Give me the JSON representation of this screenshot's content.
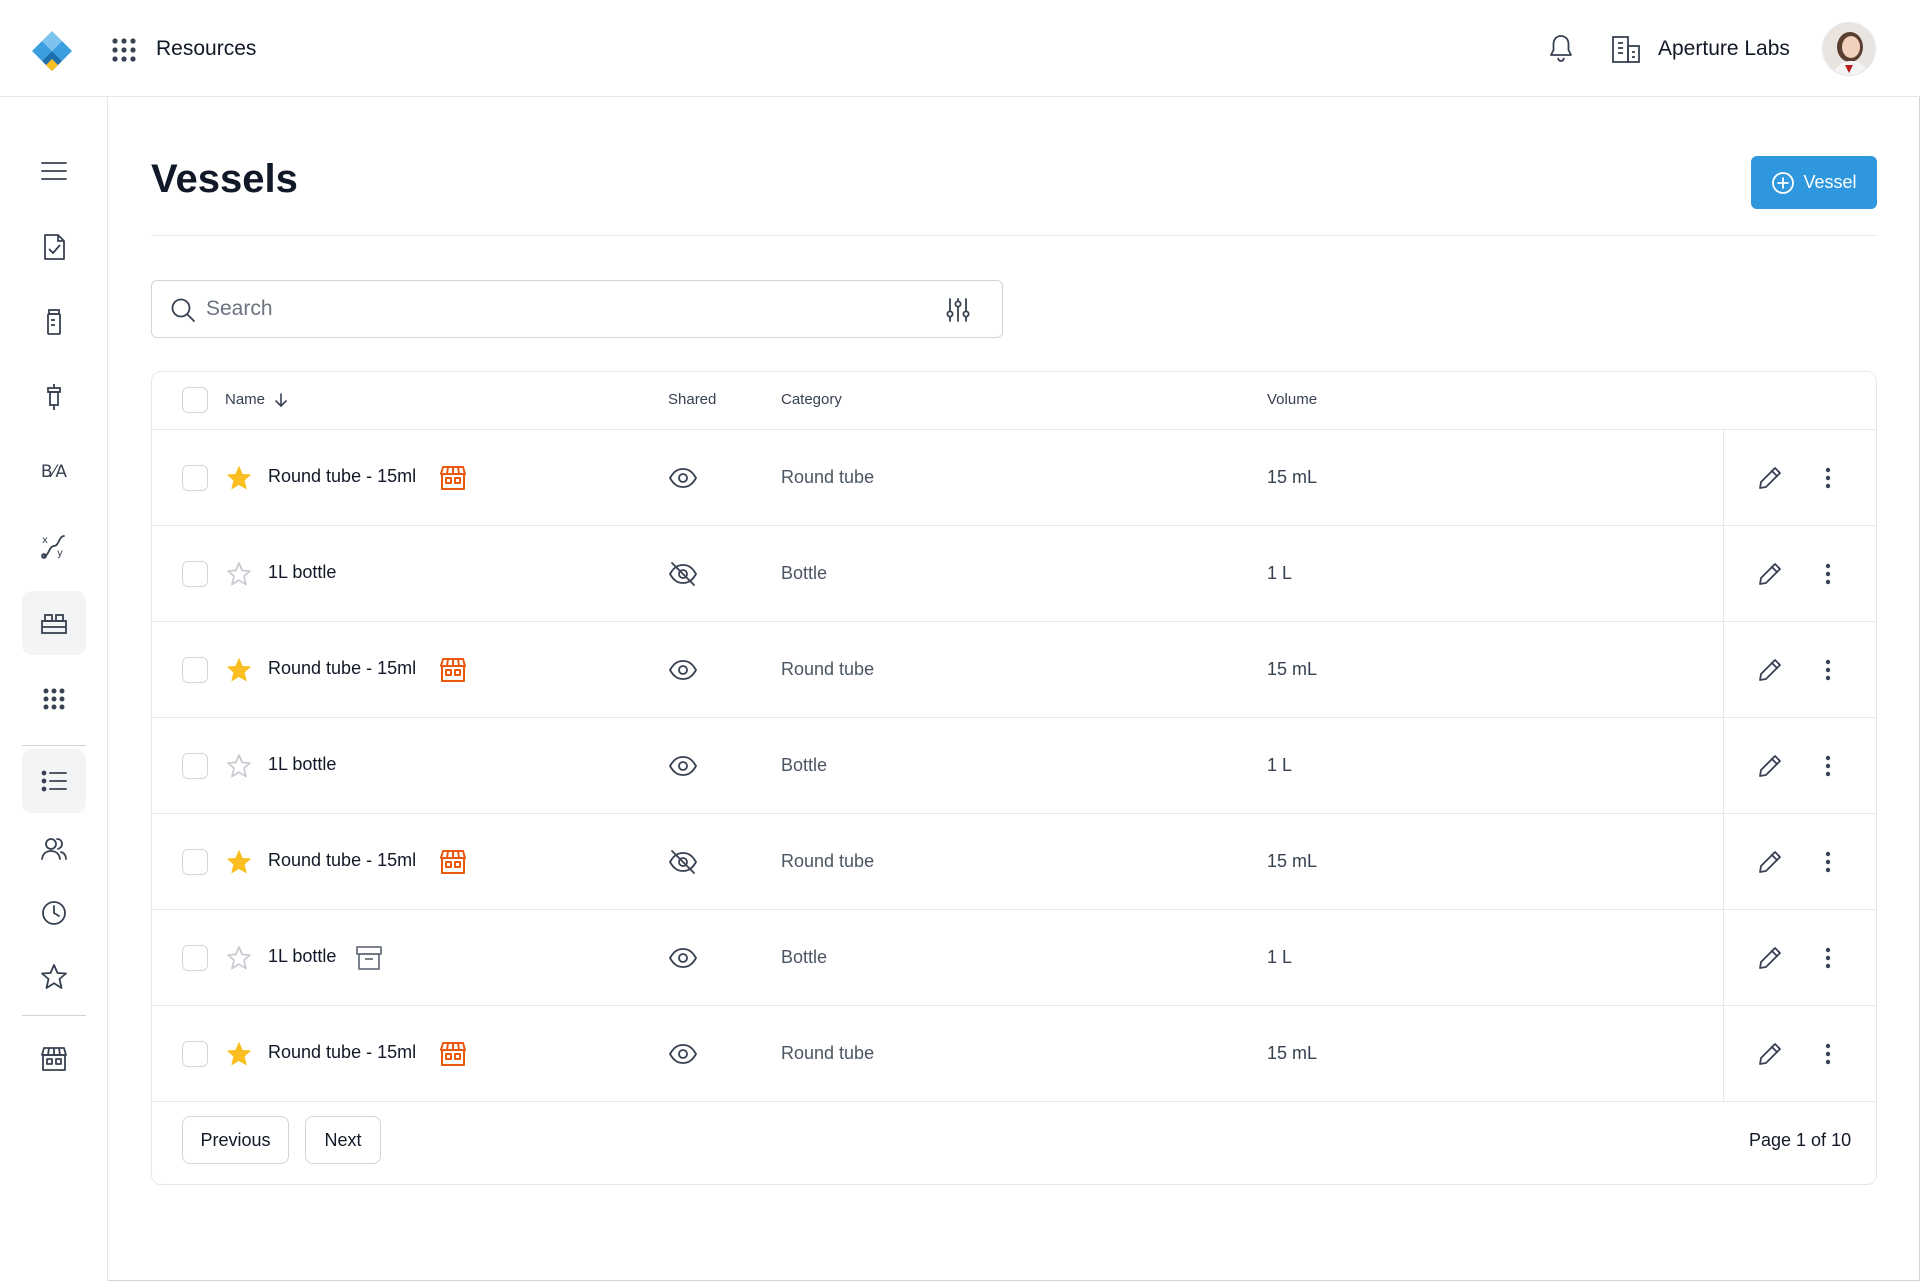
{
  "header": {
    "app_title": "Resources",
    "org_name": "Aperture Labs"
  },
  "sidebar": {
    "items": [
      {
        "icon": "menu-icon"
      },
      {
        "icon": "clipboard-check-icon"
      },
      {
        "icon": "vial-icon"
      },
      {
        "icon": "pipette-icon"
      },
      {
        "icon": "b-over-a-icon",
        "text": "B⁄A"
      },
      {
        "icon": "xy-function-icon"
      },
      {
        "icon": "vessels-icon",
        "active": true
      },
      {
        "icon": "apps-grid-icon"
      },
      {
        "icon": "list-icon",
        "active": true
      },
      {
        "icon": "users-icon"
      },
      {
        "icon": "clock-icon"
      },
      {
        "icon": "star-icon"
      },
      {
        "icon": "store-icon"
      }
    ]
  },
  "page": {
    "title": "Vessels",
    "add_button_label": "Vessel"
  },
  "search": {
    "placeholder": "Search"
  },
  "table": {
    "columns": {
      "name": "Name",
      "shared": "Shared",
      "category": "Category",
      "volume": "Volume"
    },
    "rows": [
      {
        "name": "Round tube - 15ml",
        "starred": true,
        "badge": "store-icon",
        "shared": true,
        "category": "Round tube",
        "volume": "15 mL"
      },
      {
        "name": "1L bottle",
        "starred": false,
        "badge": "",
        "shared": false,
        "category": "Bottle",
        "volume": "1 L"
      },
      {
        "name": "Round tube - 15ml",
        "starred": true,
        "badge": "store-icon",
        "shared": true,
        "category": "Round tube",
        "volume": "15 mL"
      },
      {
        "name": "1L bottle",
        "starred": false,
        "badge": "",
        "shared": true,
        "category": "Bottle",
        "volume": "1 L"
      },
      {
        "name": "Round tube - 15ml",
        "starred": true,
        "badge": "store-icon",
        "shared": false,
        "category": "Round tube",
        "volume": "15 mL"
      },
      {
        "name": "1L bottle",
        "starred": false,
        "badge": "archive-icon",
        "shared": true,
        "category": "Bottle",
        "volume": "1 L"
      },
      {
        "name": "Round tube - 15ml",
        "starred": true,
        "badge": "store-icon",
        "shared": true,
        "category": "Round tube",
        "volume": "15 mL"
      }
    ]
  },
  "pagination": {
    "previous_label": "Previous",
    "next_label": "Next",
    "page_info": "Page 1 of 10"
  },
  "colors": {
    "accent": "#2f97dd",
    "star_filled": "#fbbf24",
    "store_badge": "#ea580c",
    "icon_gray": "#374151"
  }
}
